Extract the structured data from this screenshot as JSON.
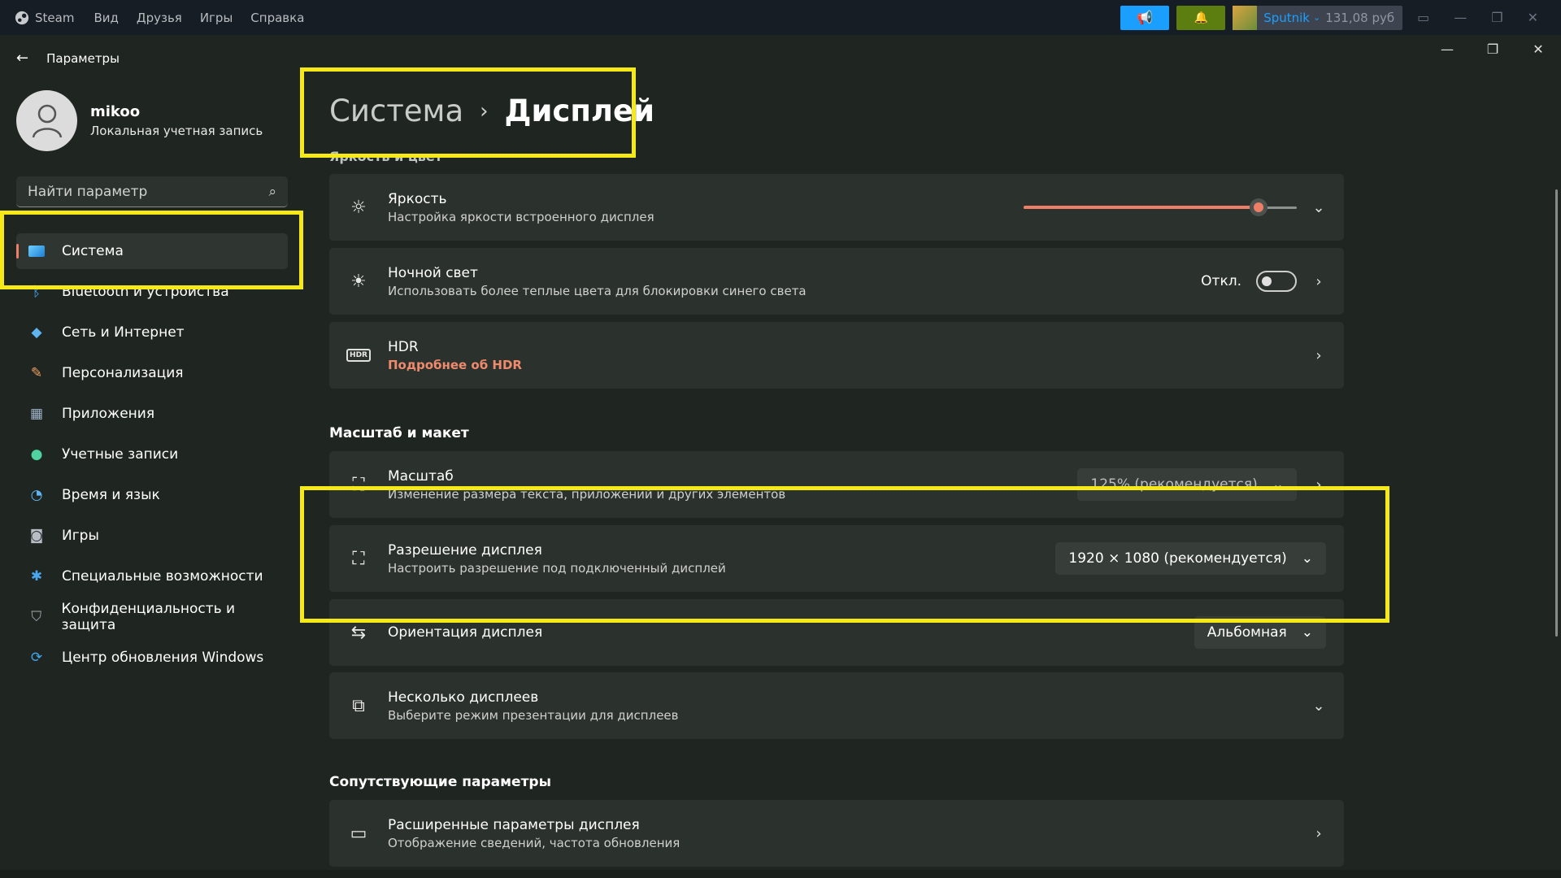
{
  "steam": {
    "brand": "Steam",
    "menu": [
      "Вид",
      "Друзья",
      "Игры",
      "Справка"
    ],
    "username": "Sputnik",
    "balance": "131,08 руб",
    "colors": {
      "bar": "#171d25",
      "blue": "#1a9fff",
      "green": "#5c7e10"
    }
  },
  "settings": {
    "window_title": "Параметры",
    "profile": {
      "name": "mikoo",
      "account_type": "Локальная учетная запись"
    },
    "search_placeholder": "Найти параметр",
    "nav": [
      {
        "label": "Система",
        "icon": "monitor-icon",
        "active": true
      },
      {
        "label": "Bluetooth и устройства",
        "icon": "bluetooth-icon"
      },
      {
        "label": "Сеть и Интернет",
        "icon": "wifi-icon"
      },
      {
        "label": "Персонализация",
        "icon": "brush-icon"
      },
      {
        "label": "Приложения",
        "icon": "apps-icon"
      },
      {
        "label": "Учетные записи",
        "icon": "person-icon"
      },
      {
        "label": "Время и язык",
        "icon": "globe-clock-icon"
      },
      {
        "label": "Игры",
        "icon": "gamepad-icon"
      },
      {
        "label": "Специальные возможности",
        "icon": "accessibility-icon"
      },
      {
        "label": "Конфиденциальность и защита",
        "icon": "shield-icon"
      },
      {
        "label": "Центр обновления Windows",
        "icon": "update-icon"
      }
    ],
    "breadcrumb": {
      "parent": "Система",
      "current": "Дисплей"
    },
    "sections": {
      "brightness_color": "Яркость и цвет",
      "scale_layout": "Масштаб и макет",
      "related": "Сопутствующие параметры"
    },
    "brightness": {
      "title": "Яркость",
      "subtitle": "Настройка яркости встроенного дисплея",
      "value_fraction": 0.86
    },
    "night_light": {
      "title": "Ночной свет",
      "subtitle": "Использовать более теплые цвета для блокировки синего света",
      "state": "Откл."
    },
    "hdr": {
      "title": "HDR",
      "link": "Подробнее об HDR",
      "badge": "HDR"
    },
    "scale": {
      "title": "Масштаб",
      "subtitle": "Изменение размера текста, приложений и других элементов",
      "value": "125% (рекомендуется)"
    },
    "resolution": {
      "title": "Разрешение дисплея",
      "subtitle": "Настроить разрешение под подключенный дисплей",
      "value": "1920 × 1080 (рекомендуется)"
    },
    "orientation": {
      "title": "Ориентация дисплея",
      "value": "Альбомная"
    },
    "multi_display": {
      "title": "Несколько дисплеев",
      "subtitle": "Выберите режим презентации для дисплеев"
    },
    "advanced": {
      "title": "Расширенные параметры дисплея",
      "subtitle": "Отображение сведений, частота обновления"
    },
    "accent_color": "#ef7e66",
    "highlight_color": "#f5ea18"
  }
}
